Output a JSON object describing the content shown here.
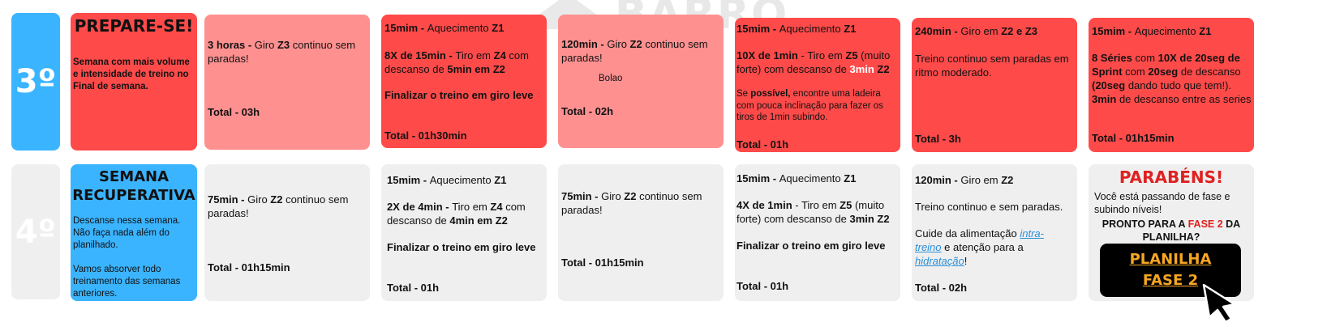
{
  "watermark": {
    "text": "BARRO"
  },
  "rows": [
    {
      "week": "3º",
      "intro": {
        "title": "PREPARE-SE!",
        "text": "Semana com mais volume e intensidade de treino no Final de semana."
      },
      "c1": {
        "l1a": "3 horas - ",
        "l1b": " Giro ",
        "l1c": "Z3",
        "l1d": " continuo sem paradas!",
        "total": "Total - 03h"
      },
      "c2": {
        "l1a": "15mim - ",
        "l1b": "Aquecimento ",
        "l1c": "Z1",
        "l2a": "8X de 15min - ",
        "l2b": "Tiro em ",
        "l2c": "Z4",
        "l2d": " com descanso de ",
        "l2e": "5min em Z2",
        "l3": "Finalizar o treino em giro leve",
        "total": "Total - 01h30min"
      },
      "c3": {
        "l1a": "120min - ",
        "l1b": "Giro ",
        "l1c": "Z2",
        "l1d": " continuo sem paradas!",
        "note": "Bolao",
        "total": "Total - 02h"
      },
      "c4": {
        "l1a": "15mim - ",
        "l1b": "Aquecimento ",
        "l1c": "Z1",
        "l2a": "10X de 1min",
        "l2b": " - Tiro em ",
        "l2c": "Z5",
        "l2d": " (muito forte) com descanso de ",
        "l2e": "3min",
        "l2f": " Z2",
        "l3a": "Se ",
        "l3b": "possível,",
        "l3c": " encontre uma ladeira com pouca inclinação para fazer os tiros de 1min subindo.",
        "total": "Total - 01h"
      },
      "c5": {
        "l1a": "240min - ",
        "l1b": "Giro em ",
        "l1c": "Z2 e Z3",
        "l2": "Treino continuo sem paradas em ritmo moderado.",
        "total": "Total - 3h"
      },
      "c6": {
        "l1a": "15mim - ",
        "l1b": "Aquecimento ",
        "l1c": "Z1",
        "l2a": "8 Séries",
        "l2b": " com ",
        "l2c": "10X de 20seg de Sprint",
        "l2d": " com ",
        "l2e": "20seg",
        "l2f": " de descanso ",
        "l2g": "(20seg",
        "l2h": " dando tudo que tem!).",
        "l2i": "3min",
        "l2j": " de descanso entre as series",
        "total": "Total - 01h15min"
      }
    },
    {
      "week": "4º",
      "intro": {
        "title1": "SEMANA",
        "title2": "RECUPERATIVA",
        "p1": "Descanse nessa semana. Não faça nada além do planilhado.",
        "p2": "Vamos absorver todo treinamento das semanas anteriores."
      },
      "c1": {
        "l1a": "75min - ",
        "l1b": "Giro ",
        "l1c": "Z2",
        "l1d": " continuo sem paradas!",
        "total": "Total - 01h15min"
      },
      "c2": {
        "l1a": "15mim - ",
        "l1b": "Aquecimento ",
        "l1c": "Z1",
        "l2a": "2X de 4min - ",
        "l2b": "Tiro em ",
        "l2c": "Z4",
        "l2d": " com descanso de ",
        "l2e": "4min em Z2",
        "l3": "Finalizar o treino em giro leve",
        "total": "Total - 01h"
      },
      "c3": {
        "l1a": "75min - ",
        "l1b": "Giro ",
        "l1c": "Z2",
        "l1d": " continuo sem paradas!",
        "total": "Total - 01h15min"
      },
      "c4": {
        "l1a": "15mim - ",
        "l1b": "Aquecimento ",
        "l1c": "Z1",
        "l2a": "4X de 1min",
        "l2b": " - Tiro em ",
        "l2c": "Z5",
        "l2d": " (muito forte) com descanso de ",
        "l2e": "3min Z2",
        "l3": "Finalizar o treino em giro leve",
        "total": "Total - 01h"
      },
      "c5": {
        "l1a": "120min - ",
        "l1b": "Giro em ",
        "l1c": "Z2",
        "l2": "Treino continuo e sem paradas.",
        "l3a": "Cuide da alimentação ",
        "l3b": "intra-treino",
        "l3c": " e atenção para a ",
        "l3d": "hidratação",
        "l3e": "!",
        "total": "Total - 02h"
      },
      "c6": {
        "title": "PARABÉNS!",
        "p1": "Você está passando de fase e subindo níveis!",
        "p2a": "PRONTO PARA A ",
        "p2b": "FASE 2",
        "p2c": " DA PLANILHA?",
        "btn1": "PLANILHA",
        "btn2": "FASE 2"
      }
    }
  ],
  "colors": {
    "red": "#ff4a4a",
    "light_red": "#ff9090",
    "gray": "#efefef",
    "blue": "#3ab4ff",
    "orange": "#f5a623",
    "dark_red": "#e02020"
  }
}
